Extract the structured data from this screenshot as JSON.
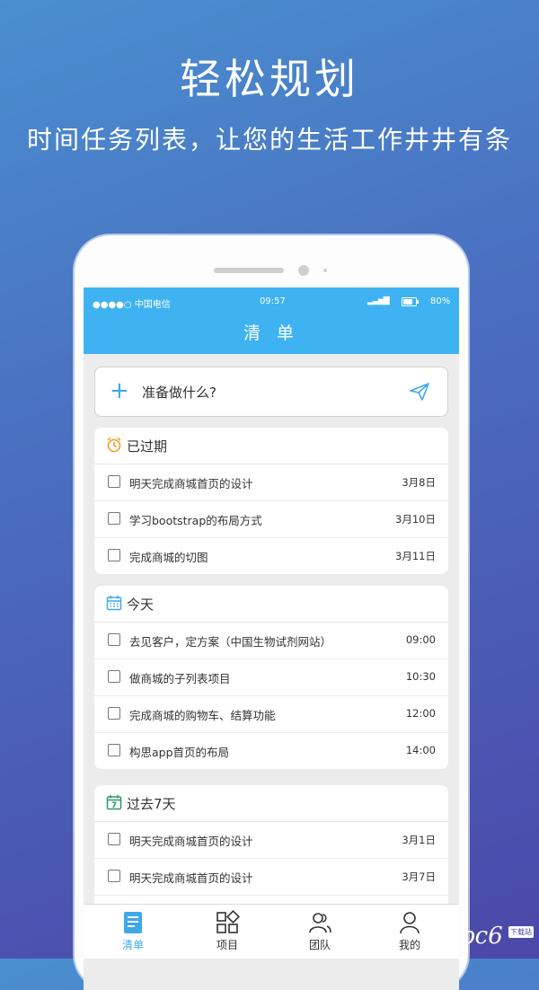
{
  "promo": {
    "headline": "轻松规划",
    "subline": "时间任务列表，让您的生活工作井井有条"
  },
  "status_bar": {
    "carrier": "●●●●○ 中国电信",
    "time": "09:57",
    "battery": "80%"
  },
  "app": {
    "title": "清 单",
    "add_placeholder": "准备做什么?"
  },
  "sections": [
    {
      "title": "已过期",
      "icon": "alarm-clock-icon",
      "items": [
        {
          "text": "明天完成商城首页的设计",
          "when": "3月8日"
        },
        {
          "text": "学习bootstrap的布局方式",
          "when": "3月10日"
        },
        {
          "text": "完成商城的切图",
          "when": "3月11日"
        }
      ]
    },
    {
      "title": "今天",
      "icon": "calendar-icon",
      "items": [
        {
          "text": "去见客户，定方案（中国生物试剂网站）",
          "when": "09:00"
        },
        {
          "text": "做商城的子列表项目",
          "when": "10:30"
        },
        {
          "text": "完成商城的购物车、结算功能",
          "when": "12:00"
        },
        {
          "text": "构思app首页的布局",
          "when": "14:00"
        }
      ]
    },
    {
      "title": "过去7天",
      "icon": "calendar-7-icon",
      "items": [
        {
          "text": "明天完成商城首页的设计",
          "when": "3月1日"
        },
        {
          "text": "明天完成商城首页的设计",
          "when": "3月7日"
        }
      ]
    }
  ],
  "tabs": [
    {
      "label": "清单",
      "icon": "list-icon",
      "active": true
    },
    {
      "label": "项目",
      "icon": "grid-icon",
      "active": false
    },
    {
      "label": "团队",
      "icon": "team-icon",
      "active": false
    },
    {
      "label": "我的",
      "icon": "person-icon",
      "active": false
    }
  ],
  "watermark": {
    "logo": "pc6",
    "tag": "下载站"
  },
  "colors": {
    "accent": "#3fb3f2",
    "icon_orange": "#f0a020",
    "icon_blue": "#3fa9e6",
    "icon_green": "#2a9a6a"
  }
}
